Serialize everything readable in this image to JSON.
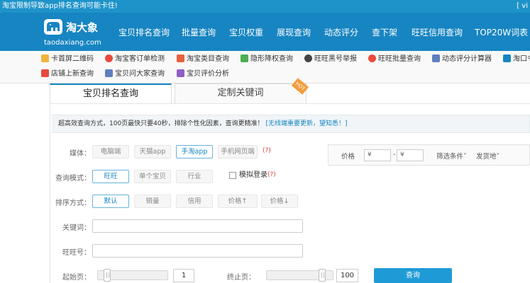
{
  "topbar": {
    "title": "淘宝限制导致app排名查询可能卡住!",
    "right": "[ vi"
  },
  "logo": {
    "name": "淘大象",
    "domain": "taodaxiang.com"
  },
  "nav": [
    "宝贝排名查询",
    "批量查询",
    "宝贝权重",
    "展现查询",
    "动态评分",
    "查下架",
    "旺旺信用查询",
    "TOP20W词表"
  ],
  "links": [
    {
      "label": "卡首屏二维码",
      "icon": "crown-icon",
      "color": "#f0b43c"
    },
    {
      "label": "淘宝客订单检测",
      "icon": "alert-icon",
      "color": "#e84a3c"
    },
    {
      "label": "淘宝类目查询",
      "icon": "category-icon",
      "color": "#e8623c"
    },
    {
      "label": "隐形降权查询",
      "icon": "shield-icon",
      "color": "#4caf50"
    },
    {
      "label": "旺旺黑号举报",
      "icon": "mask-icon",
      "color": "#444444"
    },
    {
      "label": "旺旺批量查询",
      "icon": "alert-icon",
      "color": "#e84a3c"
    },
    {
      "label": "动态评分计算器",
      "icon": "calculator-icon",
      "color": "#5f7fbf"
    },
    {
      "label": "淘口令",
      "icon": "key-icon",
      "color": "#1785c2"
    },
    {
      "label": "店铺上新查询",
      "icon": "new-icon",
      "color": "#e84a3c"
    },
    {
      "label": "宝贝问大家查询",
      "icon": "question-icon",
      "color": "#5f7fbf"
    },
    {
      "label": "宝贝评价分析",
      "icon": "review-icon",
      "color": "#8e5fc4"
    }
  ],
  "tabs": {
    "active": "宝贝排名查询",
    "alt": "定制关键词",
    "corner": "HOT"
  },
  "notice": {
    "text": "超高效查询方式，100页最快只要40秒，排除个性化因素，查询更精准！",
    "link": "[无线端重要更新，望知悉！]"
  },
  "form": {
    "media_label": "媒体：",
    "media": [
      "电脑端",
      "天猫app",
      "手淘app",
      "手机网页端"
    ],
    "query_label": "查询模式：",
    "query": [
      "旺旺",
      "单个宝贝",
      "行业"
    ],
    "simulate": "模拟登录",
    "help": "(?)",
    "sort_label": "排序方式：",
    "sort": [
      "默认",
      "销量",
      "信用",
      "价格↑",
      "价格↓"
    ],
    "keyword_label": "关键词：",
    "keyword_value": "",
    "wangwang_label": "旺旺号：",
    "wangwang_value": "",
    "start_label": "起始页：",
    "start_value": "1",
    "end_label": "终止页：",
    "end_value": "100",
    "submit": "查询"
  },
  "price": {
    "label": "价格",
    "min": "¥",
    "dash": "-",
    "max": "¥",
    "filter": "筛选条件",
    "ship": "发货地"
  }
}
